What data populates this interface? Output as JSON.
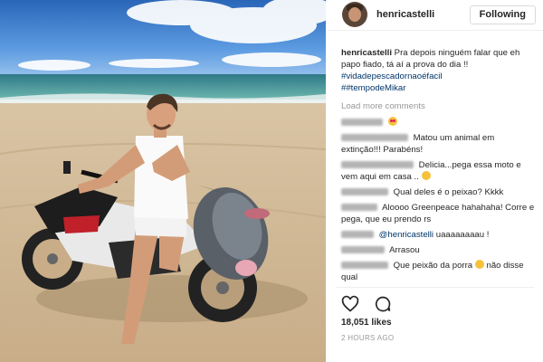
{
  "post": {
    "photo_alt": "photo-beach-motorcycle-fish"
  },
  "header": {
    "username": "henricastelli",
    "follow_label": "Following"
  },
  "caption": {
    "username": "henricastelli",
    "text": "Pra depois ninguém falar que eh papo fiado, tá aí a prova do dia !!",
    "hashtag1": "#vidadepescadornaoéfacil",
    "hashtag2": "##tempodeMikar"
  },
  "load_more_label": "Load more comments",
  "comments": [
    {
      "text": "",
      "emoji": "heart-eyes"
    },
    {
      "text": "Matou um animal em extinção!!! Parabéns!"
    },
    {
      "text": "Delicia...pega essa moto e vem aqui em casa .."
    },
    {
      "text": "Qual deles é o peixao? Kkkk"
    },
    {
      "text": "Aloooo Greenpeace hahahaha! Corre e pega, que eu prendo rs"
    },
    {
      "mention": "@henricastelli",
      "text": " uaaaaaaaau !"
    },
    {
      "text": "Arrasou"
    },
    {
      "text": "Que peixão da porra",
      "trailing": " não disse qual"
    }
  ],
  "likes_label": "18,051 likes",
  "time_label": "2 HOURS AGO",
  "icons": {
    "like": "heart-outline-icon",
    "comment": "comment-bubble-icon"
  },
  "colors": {
    "link": "#003569",
    "muted": "#999999",
    "border": "#dbdbdb"
  }
}
